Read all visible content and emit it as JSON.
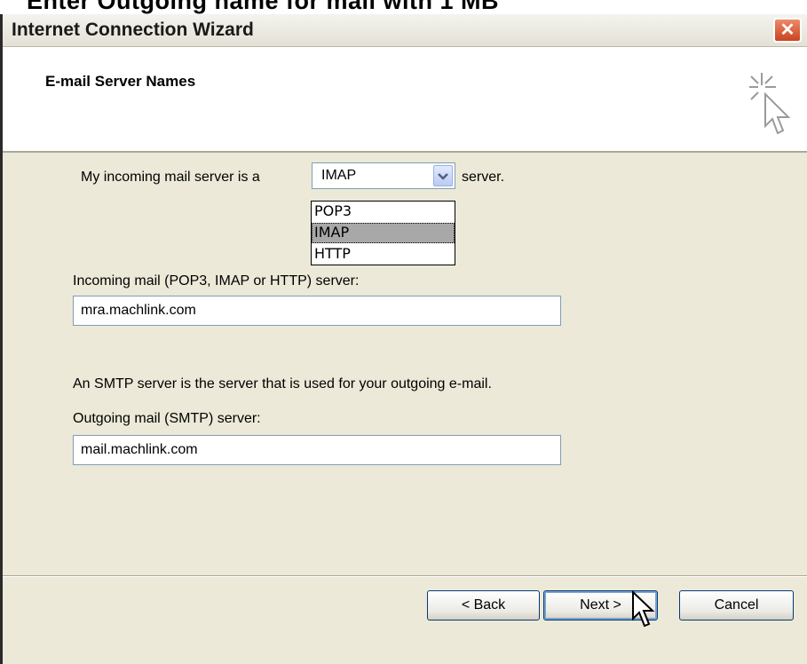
{
  "caption": "Enter Outgoing name for mail with 1 MB",
  "window": {
    "title": "Internet Connection Wizard",
    "close_glyph": "✕"
  },
  "header": {
    "title": "E-mail Server Names",
    "icon": "wizard-sparkle-cursor-icon"
  },
  "form": {
    "incoming_prefix": "My incoming mail server is a",
    "server_type": "IMAP",
    "incoming_suffix": "server.",
    "server_type_options": [
      "POP3",
      "IMAP",
      "HTTP"
    ],
    "incoming_label": "Incoming mail (POP3, IMAP or HTTP) server:",
    "incoming_value": "mra.machlink.com",
    "smtp_info": "An SMTP server is the server that is used for your outgoing e-mail.",
    "outgoing_label": "Outgoing mail (SMTP) server:",
    "outgoing_value": "mail.machlink.com"
  },
  "buttons": {
    "back": "< Back",
    "next": "Next >",
    "cancel": "Cancel"
  }
}
